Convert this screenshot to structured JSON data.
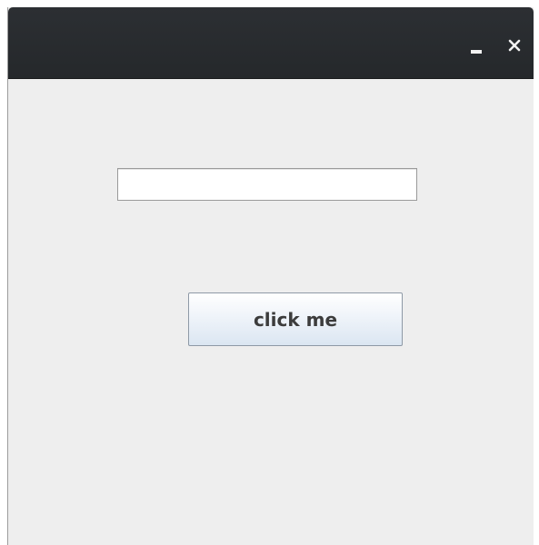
{
  "window": {
    "titlebar": {
      "minimize_icon": "minimize-icon",
      "close_icon": "close-icon",
      "close_glyph": "✕",
      "background_color": "#2a2d30"
    },
    "content": {
      "text_field": {
        "value": "",
        "placeholder": ""
      },
      "button": {
        "label": "click me"
      },
      "background_color": "#eeeeee"
    }
  }
}
